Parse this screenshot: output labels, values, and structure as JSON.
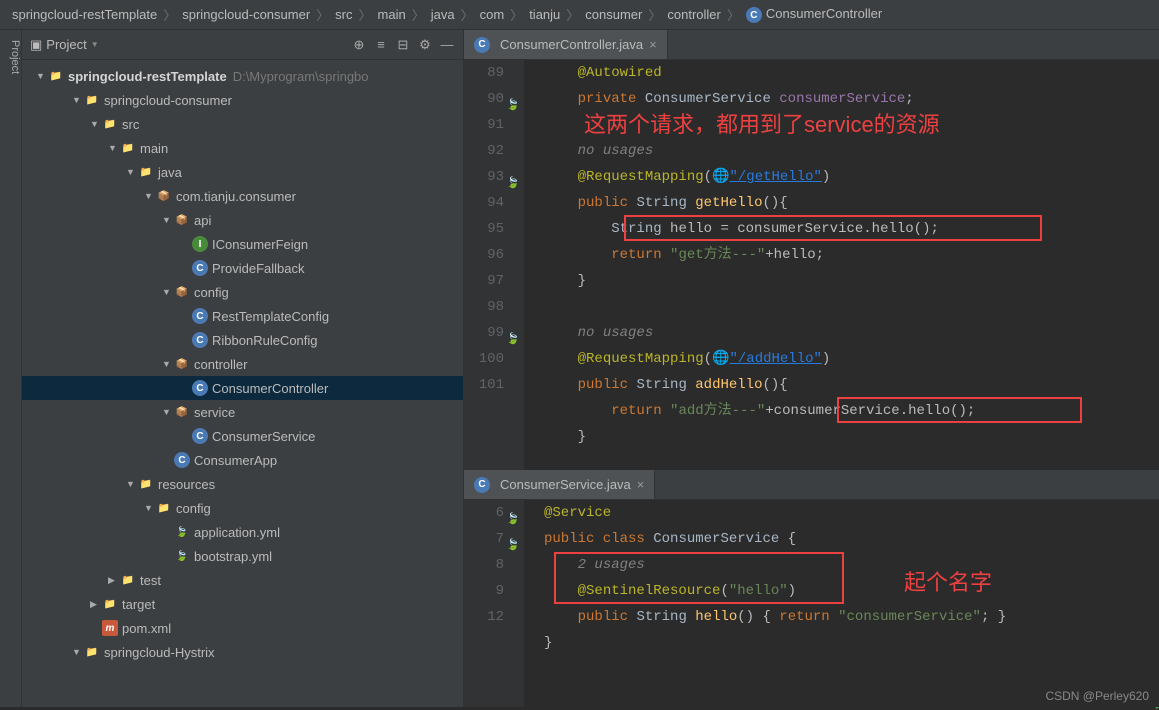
{
  "breadcrumb": [
    "springcloud-restTemplate",
    "springcloud-consumer",
    "src",
    "main",
    "java",
    "com",
    "tianju",
    "consumer",
    "controller",
    "ConsumerController"
  ],
  "panel": {
    "title": "Project"
  },
  "tree": {
    "root": "springcloud-restTemplate",
    "rootPath": "D:\\Myprogram\\springbo",
    "items": [
      {
        "label": "springcloud-consumer",
        "indent": 2,
        "icon": "folder",
        "exp": true
      },
      {
        "label": "src",
        "indent": 3,
        "icon": "folder",
        "exp": true
      },
      {
        "label": "main",
        "indent": 4,
        "icon": "folder",
        "exp": true
      },
      {
        "label": "java",
        "indent": 5,
        "icon": "folder-src",
        "exp": true
      },
      {
        "label": "com.tianju.consumer",
        "indent": 6,
        "icon": "pkg",
        "exp": true
      },
      {
        "label": "api",
        "indent": 7,
        "icon": "pkg",
        "exp": true
      },
      {
        "label": "IConsumerFeign",
        "indent": 8,
        "icon": "interface"
      },
      {
        "label": "ProvideFallback",
        "indent": 8,
        "icon": "class"
      },
      {
        "label": "config",
        "indent": 7,
        "icon": "pkg",
        "exp": true
      },
      {
        "label": "RestTemplateConfig",
        "indent": 8,
        "icon": "class"
      },
      {
        "label": "RibbonRuleConfig",
        "indent": 8,
        "icon": "class"
      },
      {
        "label": "controller",
        "indent": 7,
        "icon": "pkg",
        "exp": true
      },
      {
        "label": "ConsumerController",
        "indent": 8,
        "icon": "class",
        "selected": true
      },
      {
        "label": "service",
        "indent": 7,
        "icon": "pkg",
        "exp": true
      },
      {
        "label": "ConsumerService",
        "indent": 8,
        "icon": "class"
      },
      {
        "label": "ConsumerApp",
        "indent": 7,
        "icon": "classex"
      },
      {
        "label": "resources",
        "indent": 5,
        "icon": "folder-res",
        "exp": true
      },
      {
        "label": "config",
        "indent": 6,
        "icon": "folder",
        "exp": true
      },
      {
        "label": "application.yml",
        "indent": 7,
        "icon": "yml"
      },
      {
        "label": "bootstrap.yml",
        "indent": 7,
        "icon": "yml"
      },
      {
        "label": "test",
        "indent": 4,
        "icon": "folder",
        "exp": false
      },
      {
        "label": "target",
        "indent": 3,
        "icon": "folder-target",
        "exp": false
      },
      {
        "label": "pom.xml",
        "indent": 3,
        "icon": "maven"
      },
      {
        "label": "springcloud-Hystrix",
        "indent": 2,
        "icon": "folder",
        "exp": true
      }
    ]
  },
  "editor1": {
    "tab": "ConsumerController.java",
    "annotation1": "这两个请求，都用到了service的资源",
    "lines": [
      {
        "n": "89",
        "html": "    <span class='c-ann'>@Autowired</span>"
      },
      {
        "n": "90",
        "html": "    <span class='c-kw'>private</span> <span class='c-cls'>ConsumerService</span> <span class='c-var'>consumerService</span>;",
        "run": true
      },
      {
        "n": "91",
        "html": ""
      },
      {
        "n": "",
        "html": "    <span class='c-cmt'>no usages</span>"
      },
      {
        "n": "92",
        "html": "    <span class='c-ann'>@RequestMapping</span>(🌐<span class='c-link'>\"/getHello\"</span>)"
      },
      {
        "n": "93",
        "html": "    <span class='c-kw'>public</span> <span class='c-cls'>String</span> <span class='c-fn'>getHello</span>(){",
        "run": true
      },
      {
        "n": "94",
        "html": "        <span class='c-cls'>String</span> hello = consumerService.hello();"
      },
      {
        "n": "95",
        "html": "        <span class='c-kw'>return</span> <span class='c-str'>\"get方法---\"</span>+hello;"
      },
      {
        "n": "96",
        "html": "    }"
      },
      {
        "n": "97",
        "html": ""
      },
      {
        "n": "",
        "html": "    <span class='c-cmt'>no usages</span>"
      },
      {
        "n": "98",
        "html": "    <span class='c-ann'>@RequestMapping</span>(🌐<span class='c-link'>\"/addHello\"</span>)"
      },
      {
        "n": "99",
        "html": "    <span class='c-kw'>public</span> <span class='c-cls'>String</span> <span class='c-fn'>addHello</span>(){",
        "run": true
      },
      {
        "n": "100",
        "html": "        <span class='c-kw'>return</span> <span class='c-str'>\"add方法---\"</span>+consumerService.hello();"
      },
      {
        "n": "101",
        "html": "    }"
      }
    ]
  },
  "editor2": {
    "tab": "ConsumerService.java",
    "annotation1": "起个名字",
    "lines": [
      {
        "n": "6",
        "html": "<span class='c-ann'>@Service</span>",
        "run": true
      },
      {
        "n": "7",
        "html": "<span class='c-kw'>public class</span> <span class='c-cls'>ConsumerService</span> {",
        "run": true
      },
      {
        "n": "",
        "html": "    <span class='c-cmt'>2 usages</span>"
      },
      {
        "n": "8",
        "html": "    <span class='c-ann'>@SentinelResource</span>(<span class='c-str'>\"hello\"</span>)"
      },
      {
        "n": "9",
        "html": "    <span class='c-kw'>public</span> <span class='c-cls'>String</span> <span class='c-fn'>hello</span>() { <span class='c-kw'>return</span> <span class='c-str'>\"consumerService\"</span>; }"
      },
      {
        "n": "12",
        "html": "}"
      }
    ]
  },
  "watermark": "CSDN @Perley620"
}
